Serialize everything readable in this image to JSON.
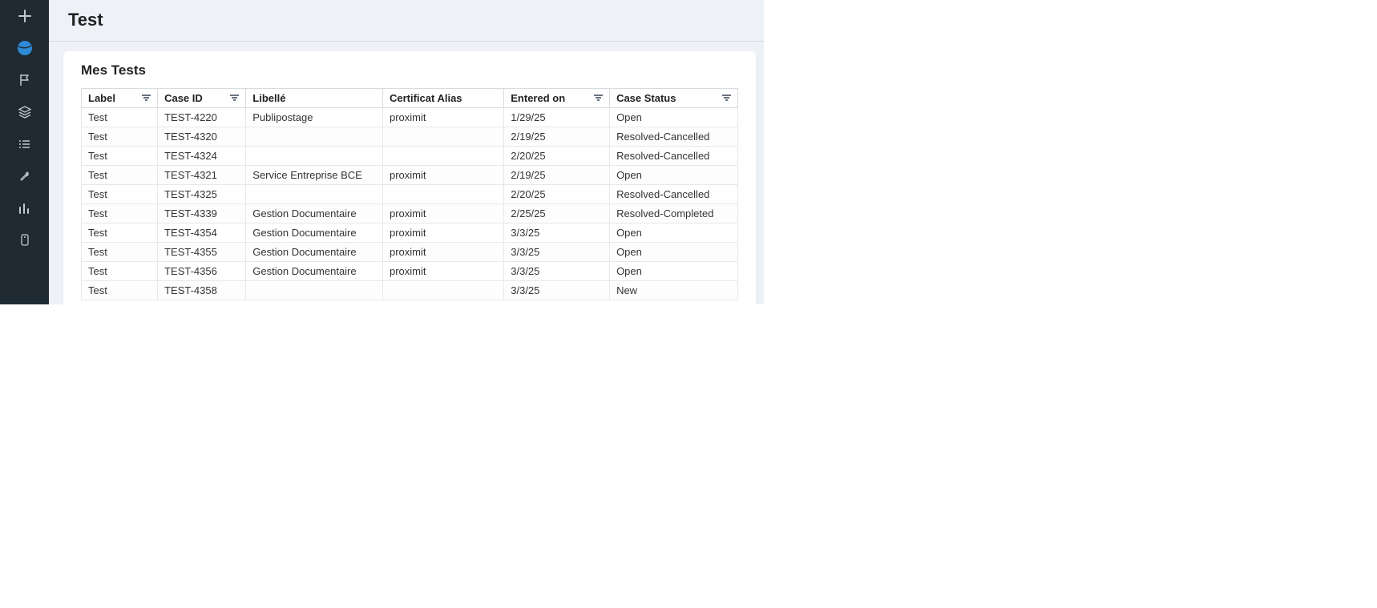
{
  "header": {
    "title": "Test"
  },
  "sidebar": {
    "items": [
      {
        "name": "plus-icon"
      },
      {
        "name": "globe-icon",
        "active": true
      },
      {
        "name": "flag-icon"
      },
      {
        "name": "layers-icon"
      },
      {
        "name": "list-icon"
      },
      {
        "name": "wrench-icon"
      },
      {
        "name": "chart-icon"
      },
      {
        "name": "tag-icon"
      }
    ]
  },
  "card": {
    "title": "Mes Tests",
    "columns": [
      {
        "key": "label",
        "label": "Label",
        "filter": true
      },
      {
        "key": "caseid",
        "label": "Case ID",
        "filter": true
      },
      {
        "key": "libelle",
        "label": "Libellé",
        "filter": false
      },
      {
        "key": "cert",
        "label": "Certificat Alias",
        "filter": false
      },
      {
        "key": "entered",
        "label": "Entered on",
        "filter": true
      },
      {
        "key": "status",
        "label": "Case Status",
        "filter": true
      }
    ],
    "rows": [
      {
        "label": "Test",
        "caseid": "TEST-4220",
        "libelle": "Publipostage",
        "cert": "proximit",
        "entered": "1/29/25",
        "status": "Open"
      },
      {
        "label": "Test",
        "caseid": "TEST-4320",
        "libelle": "",
        "cert": "",
        "entered": "2/19/25",
        "status": "Resolved-Cancelled"
      },
      {
        "label": "Test",
        "caseid": "TEST-4324",
        "libelle": "",
        "cert": "",
        "entered": "2/20/25",
        "status": "Resolved-Cancelled"
      },
      {
        "label": "Test",
        "caseid": "TEST-4321",
        "libelle": "Service Entreprise BCE",
        "cert": "proximit",
        "entered": "2/19/25",
        "status": "Open"
      },
      {
        "label": "Test",
        "caseid": "TEST-4325",
        "libelle": "",
        "cert": "",
        "entered": "2/20/25",
        "status": "Resolved-Cancelled"
      },
      {
        "label": "Test",
        "caseid": "TEST-4339",
        "libelle": "Gestion Documentaire",
        "cert": "proximit",
        "entered": "2/25/25",
        "status": "Resolved-Completed"
      },
      {
        "label": "Test",
        "caseid": "TEST-4354",
        "libelle": "Gestion Documentaire",
        "cert": "proximit",
        "entered": "3/3/25",
        "status": "Open"
      },
      {
        "label": "Test",
        "caseid": "TEST-4355",
        "libelle": "Gestion Documentaire",
        "cert": "proximit",
        "entered": "3/3/25",
        "status": "Open"
      },
      {
        "label": "Test",
        "caseid": "TEST-4356",
        "libelle": "Gestion Documentaire",
        "cert": "proximit",
        "entered": "3/3/25",
        "status": "Open"
      },
      {
        "label": "Test",
        "caseid": "TEST-4358",
        "libelle": "",
        "cert": "",
        "entered": "3/3/25",
        "status": "New"
      }
    ]
  }
}
